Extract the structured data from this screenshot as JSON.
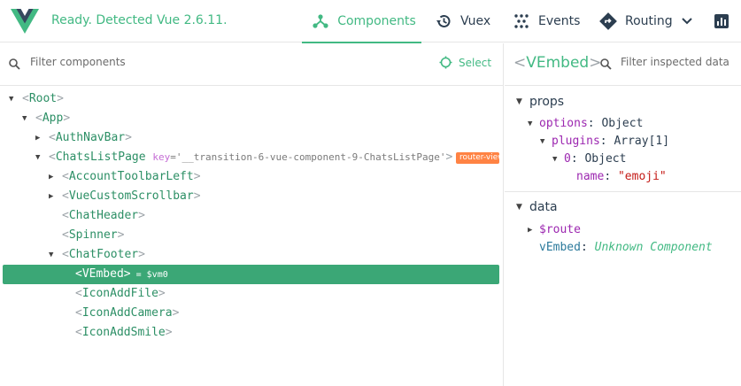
{
  "topbar": {
    "status": "Ready. Detected Vue 2.6.11.",
    "tabs": [
      {
        "label": "Components",
        "icon": "components-icon",
        "active": true
      },
      {
        "label": "Vuex",
        "icon": "history-icon",
        "active": false
      },
      {
        "label": "Events",
        "icon": "events-icon",
        "active": false
      },
      {
        "label": "Routing",
        "icon": "routing-icon",
        "active": false
      },
      {
        "label": "",
        "icon": "performance-icon",
        "active": false
      }
    ]
  },
  "component_tree": {
    "filter_placeholder": "Filter components",
    "select_label": "Select",
    "nodes": [
      {
        "name": "Root",
        "depth": 0,
        "expanded": true
      },
      {
        "name": "App",
        "depth": 1,
        "expanded": true
      },
      {
        "name": "AuthNavBar",
        "depth": 2,
        "expanded": false
      },
      {
        "name": "ChatsListPage",
        "depth": 2,
        "expanded": true,
        "key_name": "key",
        "key_value": "'__transition-6-vue-component-9-ChatsListPage'",
        "badge": "router-view"
      },
      {
        "name": "AccountToolbarLeft",
        "depth": 3,
        "expanded": false
      },
      {
        "name": "VueCustomScrollbar",
        "depth": 3,
        "expanded": false
      },
      {
        "name": "ChatHeader",
        "depth": 3
      },
      {
        "name": "Spinner",
        "depth": 3
      },
      {
        "name": "ChatFooter",
        "depth": 3,
        "expanded": true
      },
      {
        "name": "VEmbed",
        "depth": 4,
        "selected": true,
        "vm": "= $vm0"
      },
      {
        "name": "IconAddFile",
        "depth": 4
      },
      {
        "name": "IconAddCamera",
        "depth": 4
      },
      {
        "name": "IconAddSmile",
        "depth": 4
      }
    ]
  },
  "inspector": {
    "component_name": "VEmbed",
    "filter_placeholder": "Filter inspected data",
    "props_label": "props",
    "data_label": "data",
    "props": {
      "options_key": "options",
      "options_value": "Object",
      "plugins_key": "plugins",
      "plugins_value": "Array[1]",
      "item_key": "0",
      "item_value": "Object",
      "name_key": "name",
      "name_value": "\"emoji\""
    },
    "data": {
      "route_key": "$route",
      "vembed_key": "vEmbed",
      "vembed_value": "Unknown Component"
    }
  },
  "colors": {
    "accent": "#42b983",
    "selected_row": "#3ba776",
    "badge": "#ff8344"
  }
}
